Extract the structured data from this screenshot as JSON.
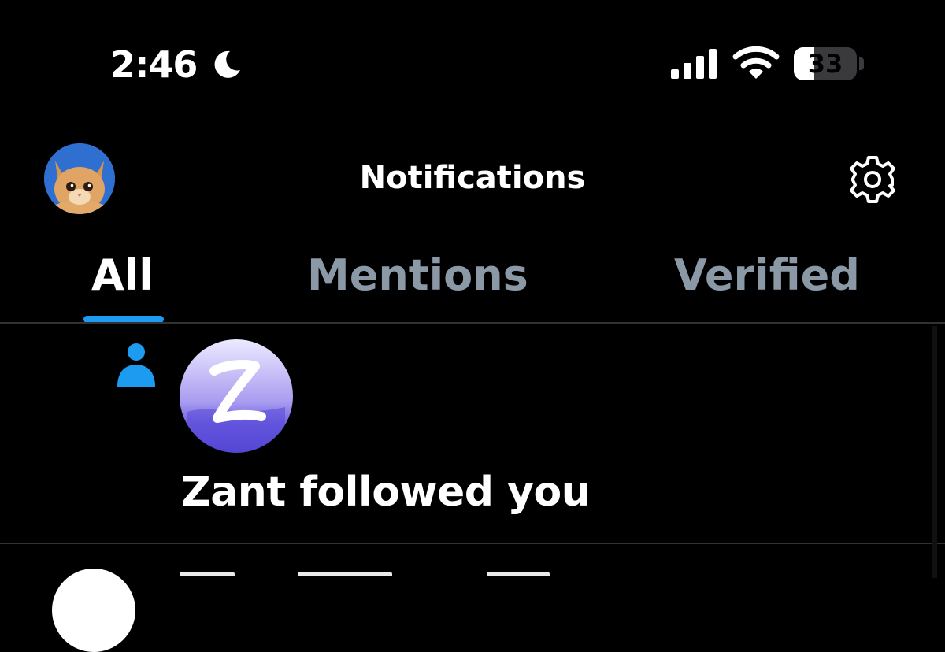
{
  "status_bar": {
    "time": "2:46",
    "focus_icon": "moon-icon",
    "signal_icon": "cellular-signal-icon",
    "wifi_icon": "wifi-icon",
    "battery_level": 33,
    "battery_label": "33"
  },
  "header": {
    "title": "Notifications",
    "avatar_icon": "cat-avatar",
    "settings_icon": "gear-icon"
  },
  "tabs": [
    {
      "label": "All",
      "active": true
    },
    {
      "label": "Mentions",
      "active": false
    },
    {
      "label": "Verified",
      "active": false
    }
  ],
  "notifications": [
    {
      "type_icon": "person-icon",
      "avatar_icon": "zant-logo",
      "text": "Zant followed you"
    }
  ],
  "colors": {
    "background": "#000000",
    "accent": "#1d9bf0",
    "inactive_tab": "#8b98a5",
    "divider": "#2f3336"
  }
}
